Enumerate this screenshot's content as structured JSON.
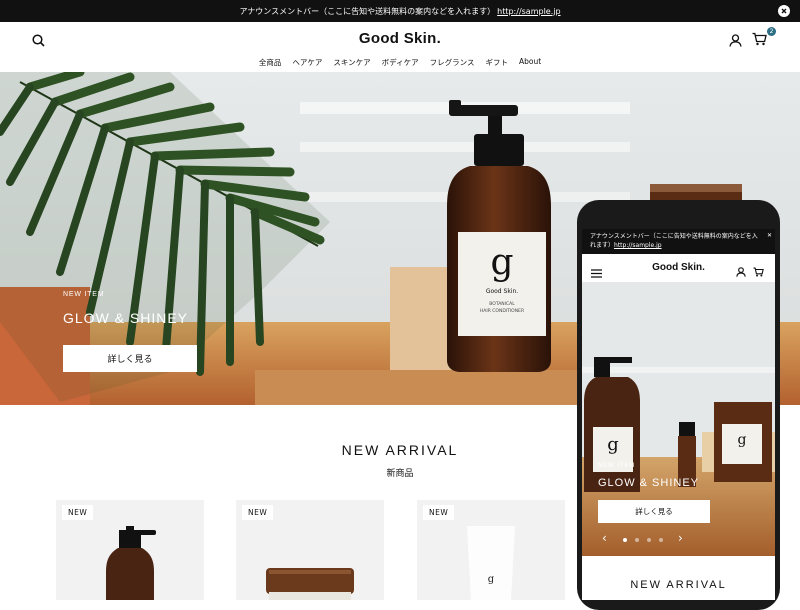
{
  "announcement": {
    "text": "アナウンスメントバー（ここに告知や送料無料の案内などを入れます）",
    "link": "http://sample.jp"
  },
  "header": {
    "logo": "Good Skin.",
    "cart_count": "2",
    "nav": [
      "全商品",
      "ヘアケア",
      "スキンケア",
      "ボディケア",
      "フレグランス",
      "ギフト",
      "About"
    ]
  },
  "hero": {
    "eyebrow": "NEW ITEM",
    "title": "GLOW & SHINEY",
    "button": "詳しく見る",
    "bottle_label_line1": "BOTANICAL",
    "bottle_label_line2": "HAIR CONDITIONER",
    "bottle_brand": "Good Skin."
  },
  "new_arrival": {
    "title": "NEW ARRIVAL",
    "subtitle": "新商品",
    "badge": "NEW"
  },
  "mobile": {
    "announcement_text": "アナウンスメントバー（ここに告知や送料無料の案内などを入れます）",
    "announcement_link": "http://sample.jp",
    "logo": "Good Skin.",
    "eyebrow": "NEW ITEM",
    "title": "GLOW & SHINEY",
    "button": "詳しく見る",
    "section_title": "NEW ARRIVAL",
    "carousel_active": 1,
    "carousel_total": 4
  },
  "colors": {
    "accent": "#2b6e85",
    "bottle": "#4a2413",
    "leaf": "#2d4a23"
  }
}
